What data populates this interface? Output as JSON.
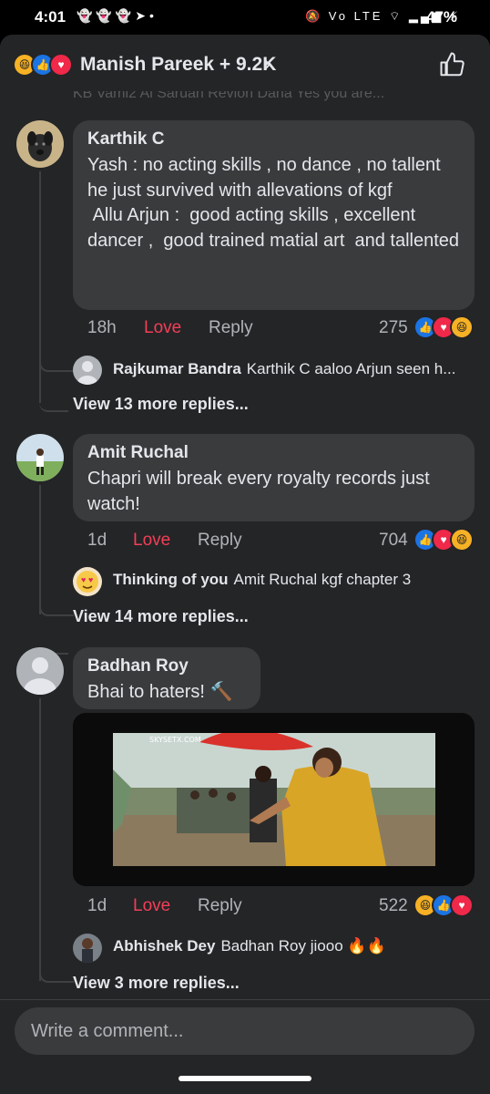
{
  "status": {
    "time": "4:01",
    "left_icons": "👻👻👻➤•",
    "right_icons": "🔕 Vo LTE ⌔ ▂▄▆ ⚡",
    "battery": "47%"
  },
  "header": {
    "title": "Manish Pareek + 9.2K",
    "chevron": "›",
    "reactions": [
      "haha",
      "like",
      "love"
    ]
  },
  "partial_text": "KB Vaml2 Al Saruan  Revlon Dana  Yes you are...",
  "comments": [
    {
      "name": "Karthik C",
      "text": "Yash : no acting skills , no dance , no tallent  he just survived with allevations of kgf\n Allu Arjun :  good acting skills , excellent dancer ,  good trained matial art  and tallented",
      "time": "18h",
      "love_label": "Love",
      "reply_label": "Reply",
      "count": "275",
      "reactions": [
        "like",
        "love",
        "haha"
      ],
      "reply_preview": {
        "name": "Rajkumar Bandra",
        "text": "Karthik C aaloo Arjun seen h..."
      },
      "view_more": "View 13 more replies..."
    },
    {
      "name": "Amit Ruchal",
      "text": "Chapri will break every royalty records just watch!",
      "time": "1d",
      "love_label": "Love",
      "reply_label": "Reply",
      "count": "704",
      "reactions": [
        "like",
        "love",
        "haha"
      ],
      "reply_preview": {
        "name": "Thinking of you",
        "text": "Amit Ruchal kgf chapter 3"
      },
      "view_more": "View 14 more replies..."
    },
    {
      "name": "Badhan Roy",
      "text": "Bhai to haters! 🔨",
      "time": "1d",
      "love_label": "Love",
      "reply_label": "Reply",
      "count": "522",
      "reactions": [
        "haha",
        "like",
        "love"
      ],
      "reply_preview": {
        "name": "Abhishek Dey",
        "text": "Badhan Roy jiooo 🔥🔥"
      },
      "view_more": "View 3 more replies..."
    }
  ],
  "video": {
    "watermark": "SKYSETX.COM"
  },
  "composer": {
    "placeholder": "Write a comment..."
  },
  "colors": {
    "background": "#242526",
    "bubble": "#3a3b3c",
    "love": "#f33e58",
    "like": "#1b74e4"
  }
}
